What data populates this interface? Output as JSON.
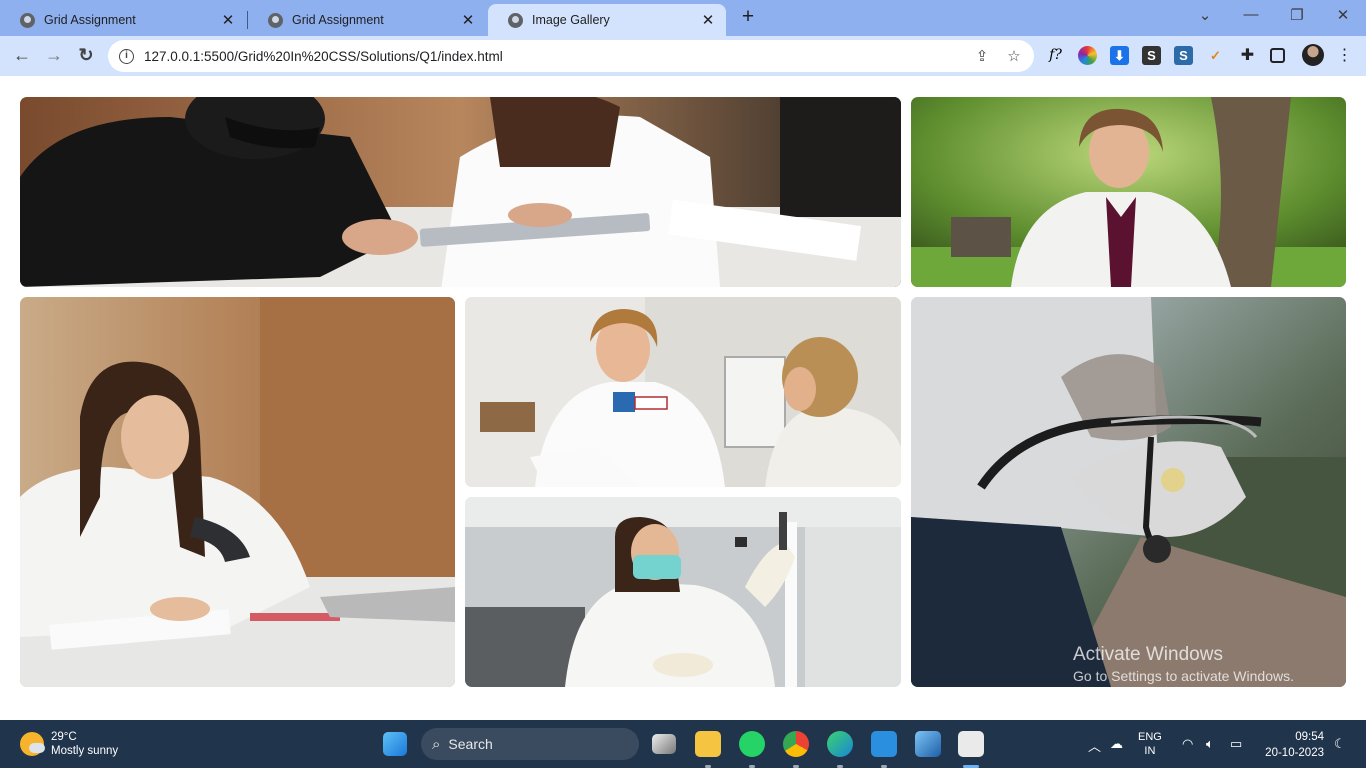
{
  "browser": {
    "tabs": [
      {
        "title": "Grid Assignment",
        "active": false,
        "icon": "globe-icon"
      },
      {
        "title": "Grid Assignment",
        "active": false,
        "icon": "globe-icon"
      },
      {
        "title": "Image Gallery",
        "active": true,
        "icon": "globe-icon"
      }
    ],
    "tab_close_glyph": "✕",
    "new_tab_glyph": "+",
    "window_controls": {
      "chevron": "⌄",
      "minimize": "—",
      "restore": "❐",
      "close": "✕"
    },
    "nav": {
      "back": "←",
      "forward": "→",
      "reload": "↻"
    },
    "url": "127.0.0.1:5500/Grid%20In%20CSS/Solutions/Q1/index.html",
    "extensions": [
      "f?",
      "color-wheel",
      "download",
      "S",
      "S",
      "user-extension",
      "puzzle",
      "sidebar",
      "profile",
      "menu"
    ]
  },
  "gallery": {
    "images": [
      {
        "name": "gallery-image-consultation",
        "description": "patient with mask and doctor writing at table"
      },
      {
        "name": "gallery-image-doctor-outdoors",
        "description": "smiling doctor in white coat near tree"
      },
      {
        "name": "gallery-image-doctor-writing",
        "description": "young doctor with stethoscope writing notes"
      },
      {
        "name": "gallery-image-doctor-patient",
        "description": "doctor smiling at older patient"
      },
      {
        "name": "gallery-image-lab-researcher",
        "description": "researcher with mask examining sample"
      },
      {
        "name": "gallery-image-stethoscope-mask",
        "description": "gloved hand holding stethoscope and mask"
      }
    ]
  },
  "watermark": {
    "line1": "Activate Windows",
    "line2": "Go to Settings to activate Windows."
  },
  "taskbar": {
    "weather": {
      "temp": "29°C",
      "condition": "Mostly sunny"
    },
    "search_label": "Search",
    "language": {
      "lang": "ENG",
      "region": "IN"
    },
    "clock": {
      "time": "09:54",
      "date": "20-10-2023"
    }
  }
}
